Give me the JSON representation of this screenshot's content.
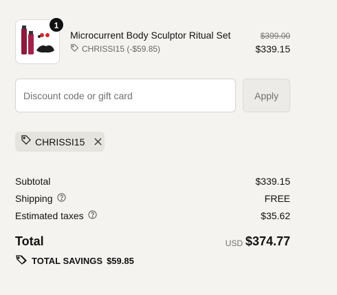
{
  "product": {
    "title": "Microcurrent Body Sculptor Ritual Set",
    "quantity": "1",
    "discount_text": "CHRISSI15 (-$59.85)",
    "original_price": "$399.00",
    "price": "$339.15",
    "thumbnail_icon": "product-image"
  },
  "discount": {
    "placeholder": "Discount code or gift card",
    "value": "",
    "apply_label": "Apply"
  },
  "applied_code": {
    "label": "CHRISSI15"
  },
  "summary": {
    "subtotal_label": "Subtotal",
    "subtotal_value": "$339.15",
    "shipping_label": "Shipping",
    "shipping_value": "FREE",
    "taxes_label": "Estimated taxes",
    "taxes_value": "$35.62",
    "total_label": "Total",
    "currency": "USD",
    "total_value": "$374.77",
    "savings_label": "TOTAL SAVINGS",
    "savings_value": "$59.85"
  },
  "colors": {
    "background": "#f4f3f0",
    "text": "#111111",
    "muted": "#707070",
    "chip_bg": "#e6e4df"
  }
}
